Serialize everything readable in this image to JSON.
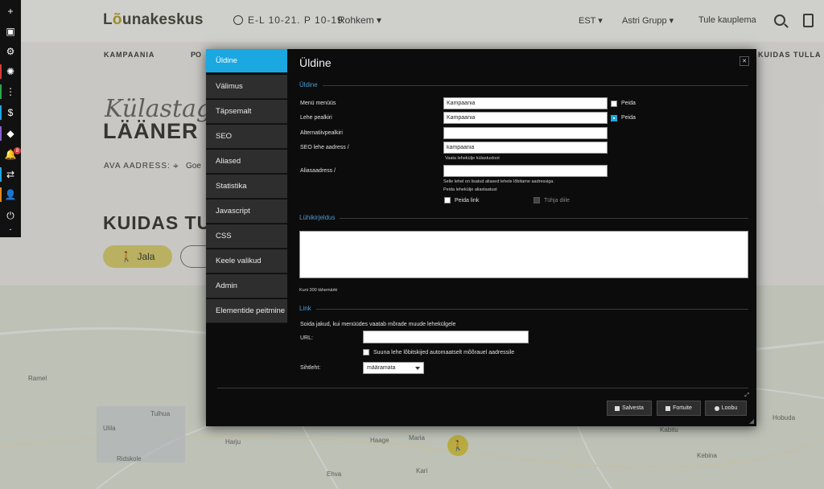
{
  "site": {
    "logo_prefix": "L",
    "logo_o": "õ",
    "logo_rest": "unakeskus",
    "hours": "E-L 10-21. P 10-19",
    "more": "Rohkem ▾",
    "lang": "EST ▾",
    "group": "Astri Grupp ▾",
    "cta": "Tule kauplema",
    "nav": [
      "KAMPAANIA",
      "PO",
      "KUIDAS TULLA"
    ],
    "hero_script": "Külastage",
    "hero_big": "LÄÄNER",
    "address_label": "AVA AADRESS:",
    "address_value": "Goe",
    "how_heading": "KUIDAS TU",
    "walk_label": "Jala",
    "map_labels": [
      "Ramel",
      "Tulhua",
      "Ulila",
      "Ridskole",
      "Harju",
      "Haage",
      "Maria",
      "Kari",
      "Ehva",
      "Kabitu",
      "Kebina",
      "Hobuda"
    ]
  },
  "toolbar": {
    "tools": [
      "plus-icon",
      "layout-icon",
      "gear-icon",
      "bug-icon",
      "dots-icon",
      "dollar-icon",
      "eraser-icon",
      "bell-icon",
      "swap-icon",
      "user-icon",
      "power-icon"
    ],
    "glyphs": [
      "+",
      "▣",
      "⚙",
      "✺",
      "⋮",
      "$",
      "◆",
      "🔔",
      "⇄",
      "👤",
      "⏻"
    ],
    "marks": [
      "",
      "",
      "",
      "#d63a3a",
      "#2ba84a",
      "#1ba7e0",
      "#8a5cd0",
      "",
      "#1ba7e0",
      "#e08a1b",
      ""
    ],
    "notif_count": "8",
    "bottom_dash": "-"
  },
  "modal": {
    "tabs": [
      "Üldine",
      "Välimus",
      "Täpsemalt",
      "SEO",
      "Aliased",
      "Statistika",
      "Javascript",
      "CSS",
      "Keele valikud",
      "Admin",
      "Elementide peitmine"
    ],
    "title": "Üldine",
    "section_general": "Üldine",
    "section_desc": "Lühikirjeldus",
    "section_link": "Link",
    "fields": {
      "menu_name_label": "Menü menüüs",
      "menu_name_value": "Kampaania",
      "page_title_label": "Lehe pealkiri",
      "page_title_value": "Kampaania",
      "alt_title_label": "Alternatiivpealkiri",
      "alt_title_value": "",
      "seo_addr_label": "SEO lehe aadress /",
      "seo_addr_value": "kampaania",
      "seo_hint": "Vaata lehekülje külastusloot",
      "alias_label": "Aliasaadress /",
      "alias_value": "",
      "alias_hint": "Selle lehel on lisatud aliased lehele lõbitame aadressiga.",
      "alias_hint2": "Peida lehekülje aliastaatust"
    },
    "checks": {
      "hide": "Peida",
      "show": "Peida",
      "hide_link": "Peida link",
      "quick_edit": "Tühja diile"
    },
    "desc_hint": "Kuni 300 tähemärki",
    "link": {
      "hint": "Soida jakud, kui menüüdes vaatab mõrade muude lehekülgele",
      "url_label": "URL:",
      "url_value": "",
      "auto_label": "Suuna lehe lõbitskijed automaatselt mõõrauel aadressile",
      "target_label": "Sihtleht:",
      "target_value": "määramata"
    },
    "buttons": [
      "Salvesta",
      "Fortuite",
      "Loobu"
    ],
    "foot_icon": "⤢"
  }
}
